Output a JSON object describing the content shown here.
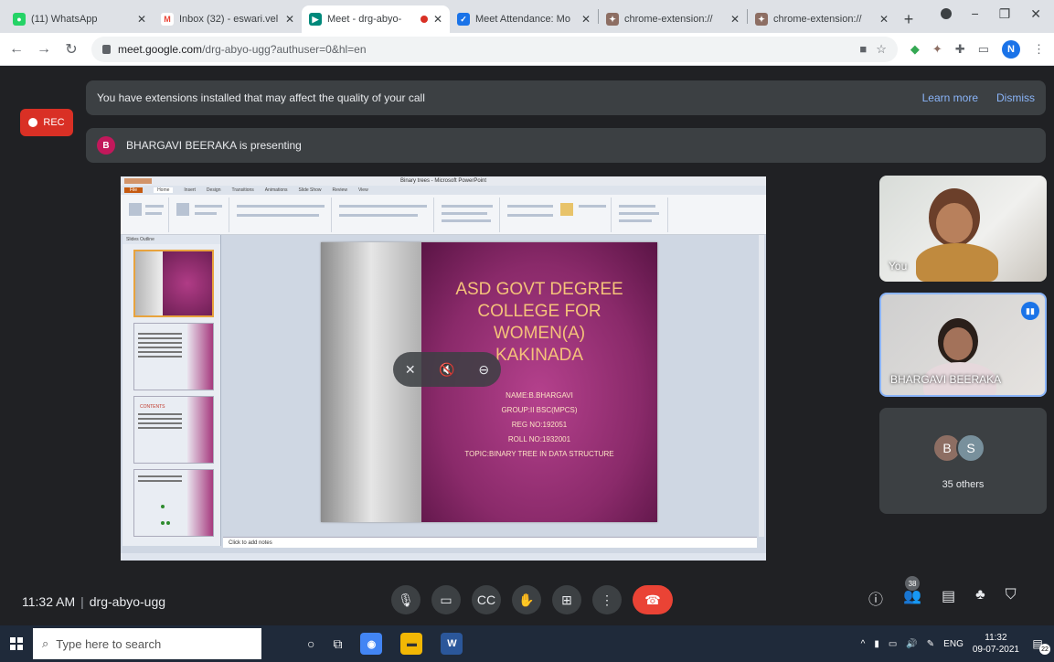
{
  "browser": {
    "tabs": [
      {
        "title": "(11) WhatsApp",
        "color": "#25d366",
        "glyph": "W"
      },
      {
        "title": "Inbox (32) - eswari.vel",
        "color": "#ea4335",
        "glyph": "M"
      },
      {
        "title": "Meet - drg-abyo-",
        "color": "#00897b",
        "glyph": "▶"
      },
      {
        "title": "Meet Attendance: Mo",
        "color": "#1a73e8",
        "glyph": "✓"
      },
      {
        "title": "chrome-extension://",
        "color": "#8d6e63",
        "glyph": "✦"
      },
      {
        "title": "chrome-extension://",
        "color": "#8d6e63",
        "glyph": "✦"
      }
    ],
    "url_host": "meet.google.com",
    "url_path": "/drg-abyo-ugg?authuser=0&hl=en",
    "profile_initial": "N"
  },
  "meet": {
    "ext_banner": "You have extensions installed that may affect the quality of your call",
    "learn_more": "Learn more",
    "dismiss": "Dismiss",
    "rec_label": "REC",
    "presenter_initial": "B",
    "presenter_text": "BHARGAVI BEERAKA is presenting",
    "tiles": {
      "you_label": "You",
      "bhargavi_label": "BHARGAVI BEERAKA",
      "others_initials": [
        "B",
        "S"
      ],
      "others_label": "35 others"
    },
    "bottom": {
      "time": "11:32 AM",
      "meeting_code": "drg-abyo-ugg",
      "people_count": "38"
    }
  },
  "slide": {
    "window_title": "Binary trees - Microsoft PowerPoint",
    "tabs": [
      "File",
      "Home",
      "Insert",
      "Design",
      "Transitions",
      "Animations",
      "Slide Show",
      "Review",
      "View"
    ],
    "thumb_tabs": "Slides   Outline",
    "title_lines": [
      "ASD GOVT DEGREE",
      "COLLEGE FOR",
      "WOMEN(A)",
      "KAKINADA"
    ],
    "info_lines": [
      "NAME:B.BHARGAVI",
      "GROUP:II BSC(MPCS)",
      "REG NO:192051",
      "ROLL NO:1932001",
      "TOPIC:BINARY TREE IN DATA STRUCTURE"
    ],
    "notes": "Click to add notes",
    "thumb_contents": "CONTENTS"
  },
  "taskbar": {
    "search_placeholder": "Type here to search",
    "lang": "ENG",
    "time": "11:32",
    "date": "09-07-2021",
    "notif_count": "22"
  }
}
